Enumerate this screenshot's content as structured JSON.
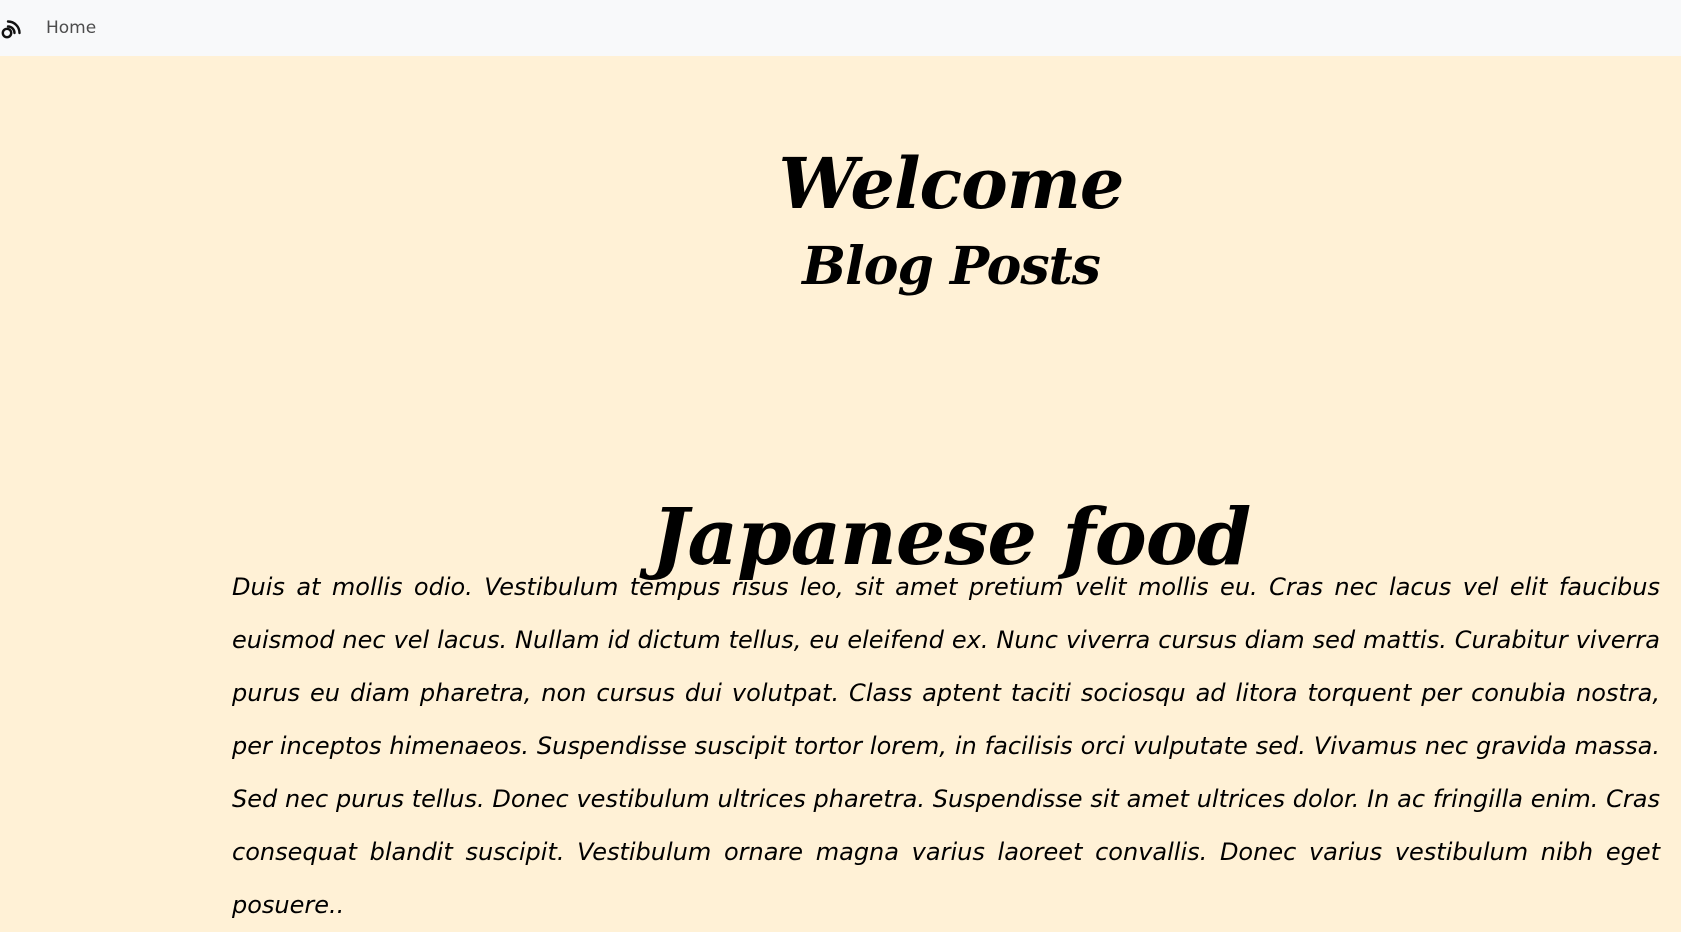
{
  "navbar": {
    "brand_icon": "rss-feed-icon",
    "home_label": "Home"
  },
  "header": {
    "title": "Welcome",
    "subtitle": "Blog Posts"
  },
  "post": {
    "title": "Japanese food",
    "body": "Duis at mollis odio. Vestibulum tempus risus leo, sit amet pretium velit mollis eu. Cras nec lacus vel elit faucibus euismod nec vel lacus. Nullam id dictum tellus, eu eleifend ex. Nunc viverra cursus diam sed mattis. Curabitur viverra purus eu diam pharetra, non cursus dui volutpat. Class aptent taciti sociosqu ad litora torquent per conubia nostra, per inceptos himenaeos. Suspendisse suscipit tortor lorem, in facilisis orci vulputate sed. Vivamus nec gravida massa. Sed nec purus tellus. Donec vestibulum ultrices pharetra. Suspendisse sit amet ultrices dolor. In ac fringilla enim. Cras consequat blandit suscipit. Vestibulum ornare magna varius laoreet convallis. Donec varius vestibulum nibh eget posuere.."
  },
  "colors": {
    "page_background": "#fff1d6",
    "navbar_background": "#f8f9fa",
    "nav_text": "#4d4d4d",
    "text": "#000000"
  }
}
